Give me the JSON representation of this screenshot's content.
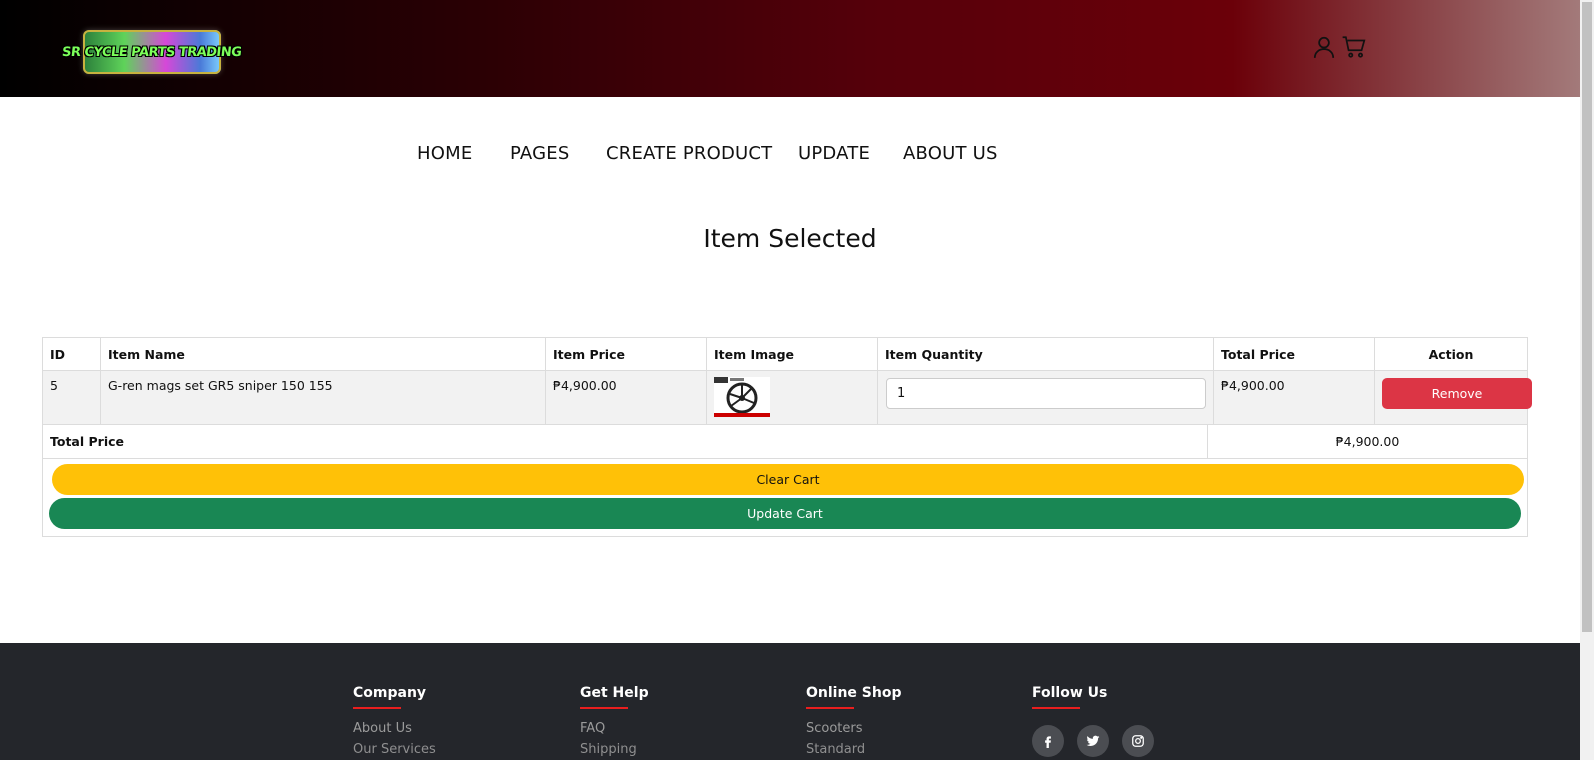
{
  "brand": {
    "logo_text": "SR CYCLE PARTS TRADING"
  },
  "header_icons": {
    "user": "user-icon",
    "cart": "cart-icon"
  },
  "nav": {
    "items": [
      {
        "label": "HOME"
      },
      {
        "label": "PAGES"
      },
      {
        "label": "CREATE PRODUCT"
      },
      {
        "label": "UPDATE"
      },
      {
        "label": "ABOUT US"
      }
    ]
  },
  "page_title": "Item Selected",
  "table": {
    "headers": [
      "ID",
      "Item Name",
      "Item Price",
      "Item Image",
      "Item Quantity",
      "Total Price",
      "Action"
    ],
    "rows": [
      {
        "id": "5",
        "name": "G-ren mags set GR5 sniper 150 155",
        "price": "₱4,900.00",
        "image_icon": "wheel-product-image",
        "quantity": "1",
        "total": "₱4,900.00",
        "action": "Remove"
      }
    ],
    "total_label": "Total Price",
    "total_value": "₱4,900.00",
    "clear_label": "Clear Cart",
    "update_label": "Update Cart"
  },
  "footer": {
    "columns": [
      {
        "title": "Company",
        "links": [
          "About Us",
          "Our Services"
        ]
      },
      {
        "title": "Get Help",
        "links": [
          "FAQ",
          "Shipping"
        ]
      },
      {
        "title": "Online Shop",
        "links": [
          "Scooters",
          "Standard"
        ]
      },
      {
        "title": "Follow Us",
        "links": []
      }
    ],
    "social_icons": [
      "facebook-icon",
      "twitter-icon",
      "instagram-icon"
    ]
  },
  "colors": {
    "remove": "#dc3545",
    "clear": "#ffc107",
    "update": "#198754",
    "footer_bg": "#24262b",
    "footer_accent": "#e91e1e"
  }
}
